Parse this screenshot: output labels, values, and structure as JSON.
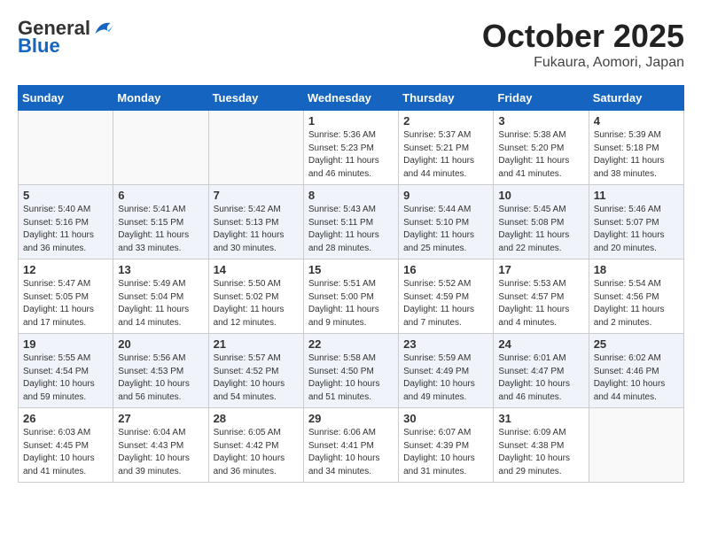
{
  "header": {
    "logo_general": "General",
    "logo_blue": "Blue",
    "month": "October 2025",
    "location": "Fukaura, Aomori, Japan"
  },
  "weekdays": [
    "Sunday",
    "Monday",
    "Tuesday",
    "Wednesday",
    "Thursday",
    "Friday",
    "Saturday"
  ],
  "weeks": [
    [
      {
        "day": "",
        "info": ""
      },
      {
        "day": "",
        "info": ""
      },
      {
        "day": "",
        "info": ""
      },
      {
        "day": "1",
        "info": "Sunrise: 5:36 AM\nSunset: 5:23 PM\nDaylight: 11 hours\nand 46 minutes."
      },
      {
        "day": "2",
        "info": "Sunrise: 5:37 AM\nSunset: 5:21 PM\nDaylight: 11 hours\nand 44 minutes."
      },
      {
        "day": "3",
        "info": "Sunrise: 5:38 AM\nSunset: 5:20 PM\nDaylight: 11 hours\nand 41 minutes."
      },
      {
        "day": "4",
        "info": "Sunrise: 5:39 AM\nSunset: 5:18 PM\nDaylight: 11 hours\nand 38 minutes."
      }
    ],
    [
      {
        "day": "5",
        "info": "Sunrise: 5:40 AM\nSunset: 5:16 PM\nDaylight: 11 hours\nand 36 minutes."
      },
      {
        "day": "6",
        "info": "Sunrise: 5:41 AM\nSunset: 5:15 PM\nDaylight: 11 hours\nand 33 minutes."
      },
      {
        "day": "7",
        "info": "Sunrise: 5:42 AM\nSunset: 5:13 PM\nDaylight: 11 hours\nand 30 minutes."
      },
      {
        "day": "8",
        "info": "Sunrise: 5:43 AM\nSunset: 5:11 PM\nDaylight: 11 hours\nand 28 minutes."
      },
      {
        "day": "9",
        "info": "Sunrise: 5:44 AM\nSunset: 5:10 PM\nDaylight: 11 hours\nand 25 minutes."
      },
      {
        "day": "10",
        "info": "Sunrise: 5:45 AM\nSunset: 5:08 PM\nDaylight: 11 hours\nand 22 minutes."
      },
      {
        "day": "11",
        "info": "Sunrise: 5:46 AM\nSunset: 5:07 PM\nDaylight: 11 hours\nand 20 minutes."
      }
    ],
    [
      {
        "day": "12",
        "info": "Sunrise: 5:47 AM\nSunset: 5:05 PM\nDaylight: 11 hours\nand 17 minutes."
      },
      {
        "day": "13",
        "info": "Sunrise: 5:49 AM\nSunset: 5:04 PM\nDaylight: 11 hours\nand 14 minutes."
      },
      {
        "day": "14",
        "info": "Sunrise: 5:50 AM\nSunset: 5:02 PM\nDaylight: 11 hours\nand 12 minutes."
      },
      {
        "day": "15",
        "info": "Sunrise: 5:51 AM\nSunset: 5:00 PM\nDaylight: 11 hours\nand 9 minutes."
      },
      {
        "day": "16",
        "info": "Sunrise: 5:52 AM\nSunset: 4:59 PM\nDaylight: 11 hours\nand 7 minutes."
      },
      {
        "day": "17",
        "info": "Sunrise: 5:53 AM\nSunset: 4:57 PM\nDaylight: 11 hours\nand 4 minutes."
      },
      {
        "day": "18",
        "info": "Sunrise: 5:54 AM\nSunset: 4:56 PM\nDaylight: 11 hours\nand 2 minutes."
      }
    ],
    [
      {
        "day": "19",
        "info": "Sunrise: 5:55 AM\nSunset: 4:54 PM\nDaylight: 10 hours\nand 59 minutes."
      },
      {
        "day": "20",
        "info": "Sunrise: 5:56 AM\nSunset: 4:53 PM\nDaylight: 10 hours\nand 56 minutes."
      },
      {
        "day": "21",
        "info": "Sunrise: 5:57 AM\nSunset: 4:52 PM\nDaylight: 10 hours\nand 54 minutes."
      },
      {
        "day": "22",
        "info": "Sunrise: 5:58 AM\nSunset: 4:50 PM\nDaylight: 10 hours\nand 51 minutes."
      },
      {
        "day": "23",
        "info": "Sunrise: 5:59 AM\nSunset: 4:49 PM\nDaylight: 10 hours\nand 49 minutes."
      },
      {
        "day": "24",
        "info": "Sunrise: 6:01 AM\nSunset: 4:47 PM\nDaylight: 10 hours\nand 46 minutes."
      },
      {
        "day": "25",
        "info": "Sunrise: 6:02 AM\nSunset: 4:46 PM\nDaylight: 10 hours\nand 44 minutes."
      }
    ],
    [
      {
        "day": "26",
        "info": "Sunrise: 6:03 AM\nSunset: 4:45 PM\nDaylight: 10 hours\nand 41 minutes."
      },
      {
        "day": "27",
        "info": "Sunrise: 6:04 AM\nSunset: 4:43 PM\nDaylight: 10 hours\nand 39 minutes."
      },
      {
        "day": "28",
        "info": "Sunrise: 6:05 AM\nSunset: 4:42 PM\nDaylight: 10 hours\nand 36 minutes."
      },
      {
        "day": "29",
        "info": "Sunrise: 6:06 AM\nSunset: 4:41 PM\nDaylight: 10 hours\nand 34 minutes."
      },
      {
        "day": "30",
        "info": "Sunrise: 6:07 AM\nSunset: 4:39 PM\nDaylight: 10 hours\nand 31 minutes."
      },
      {
        "day": "31",
        "info": "Sunrise: 6:09 AM\nSunset: 4:38 PM\nDaylight: 10 hours\nand 29 minutes."
      },
      {
        "day": "",
        "info": ""
      }
    ]
  ]
}
